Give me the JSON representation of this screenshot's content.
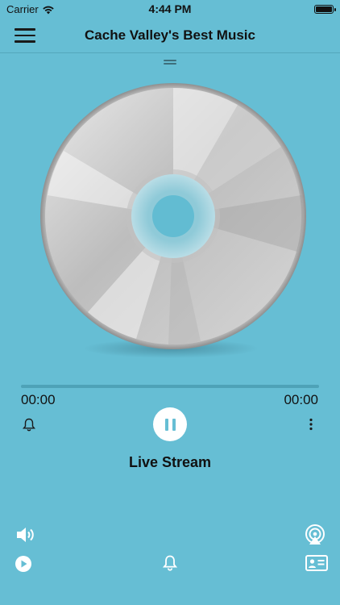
{
  "status_bar": {
    "carrier": "Carrier",
    "time": "4:44 PM",
    "wifi_icon": "wifi-icon",
    "battery_icon": "battery-icon"
  },
  "header": {
    "title": "Cache Valley's Best Music",
    "menu_icon": "hamburger-menu-icon"
  },
  "player": {
    "artwork": "cd-disc",
    "progress": 0,
    "elapsed": "00:00",
    "duration": "00:00",
    "track_title": "Live Stream",
    "state": "playing"
  },
  "controls": {
    "alarm_icon": "bell-icon",
    "more_icon": "more-vertical-icon",
    "pause_icon": "pause-icon",
    "volume_icon": "volume-icon",
    "airplay_icon": "airplay-icon",
    "play_circle_icon": "play-circle-icon",
    "bell_bottom_icon": "bell-icon",
    "contact_card_icon": "contact-card-icon"
  },
  "colors": {
    "background": "#66bed4",
    "accent": "#66bed4",
    "text": "#111111"
  }
}
